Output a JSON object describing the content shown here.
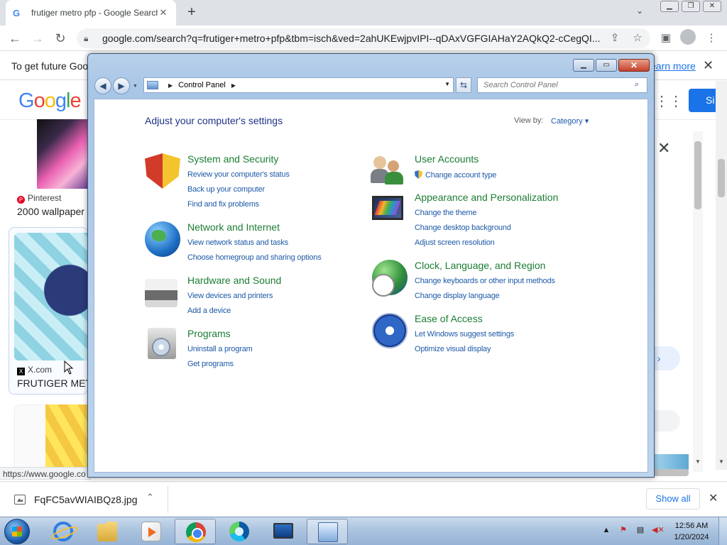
{
  "browser": {
    "tab_title": "frutiger metro pfp - Google Search",
    "tab_favicon": "G",
    "new_tab": "+",
    "url": "google.com/search?q=frutiger+metro+pfp&tbm=isch&ved=2ahUKEwjpvIPI--qDAxVGFGIAHaY2AQkQ2-cCegQI...",
    "infobar_text": "To get future Goog",
    "infobar_link": "earn more"
  },
  "google": {
    "logo_letters": [
      "G",
      "o",
      "o",
      "g",
      "l",
      "e"
    ],
    "signin_label": "Si",
    "results": [
      {
        "source": "Pinterest",
        "title": "2000 wallpaper"
      },
      {
        "source": "X.com",
        "title": "FRUTIGER MET"
      }
    ],
    "status_url": "https://www.google.co"
  },
  "downloads": {
    "file_name": "FqFC5avWIAIBQz8.jpg",
    "show_all": "Show all"
  },
  "control_panel": {
    "breadcrumb": "Control Panel",
    "search_placeholder": "Search Control Panel",
    "heading": "Adjust your computer's settings",
    "view_by_label": "View by:",
    "view_by_value": "Category",
    "categories": [
      {
        "title": "System and Security",
        "links": [
          "Review your computer's status",
          "Back up your computer",
          "Find and fix problems"
        ]
      },
      {
        "title": "Network and Internet",
        "links": [
          "View network status and tasks",
          "Choose homegroup and sharing options"
        ]
      },
      {
        "title": "Hardware and Sound",
        "links": [
          "View devices and printers",
          "Add a device"
        ]
      },
      {
        "title": "Programs",
        "links": [
          "Uninstall a program",
          "Get programs"
        ]
      },
      {
        "title": "User Accounts",
        "links": [
          "Change account type"
        ]
      },
      {
        "title": "Appearance and Personalization",
        "links": [
          "Change the theme",
          "Change desktop background",
          "Adjust screen resolution"
        ]
      },
      {
        "title": "Clock, Language, and Region",
        "links": [
          "Change keyboards or other input methods",
          "Change display language"
        ]
      },
      {
        "title": "Ease of Access",
        "links": [
          "Let Windows suggest settings",
          "Optimize visual display"
        ]
      }
    ]
  },
  "taskbar": {
    "clock_time": "12:56 AM",
    "clock_date": "1/20/2024"
  },
  "colors": {
    "link_blue": "#1e5aa8",
    "category_green": "#1c7d33",
    "heading_blue": "#1e3287",
    "google_blue": "#1a73e8"
  }
}
